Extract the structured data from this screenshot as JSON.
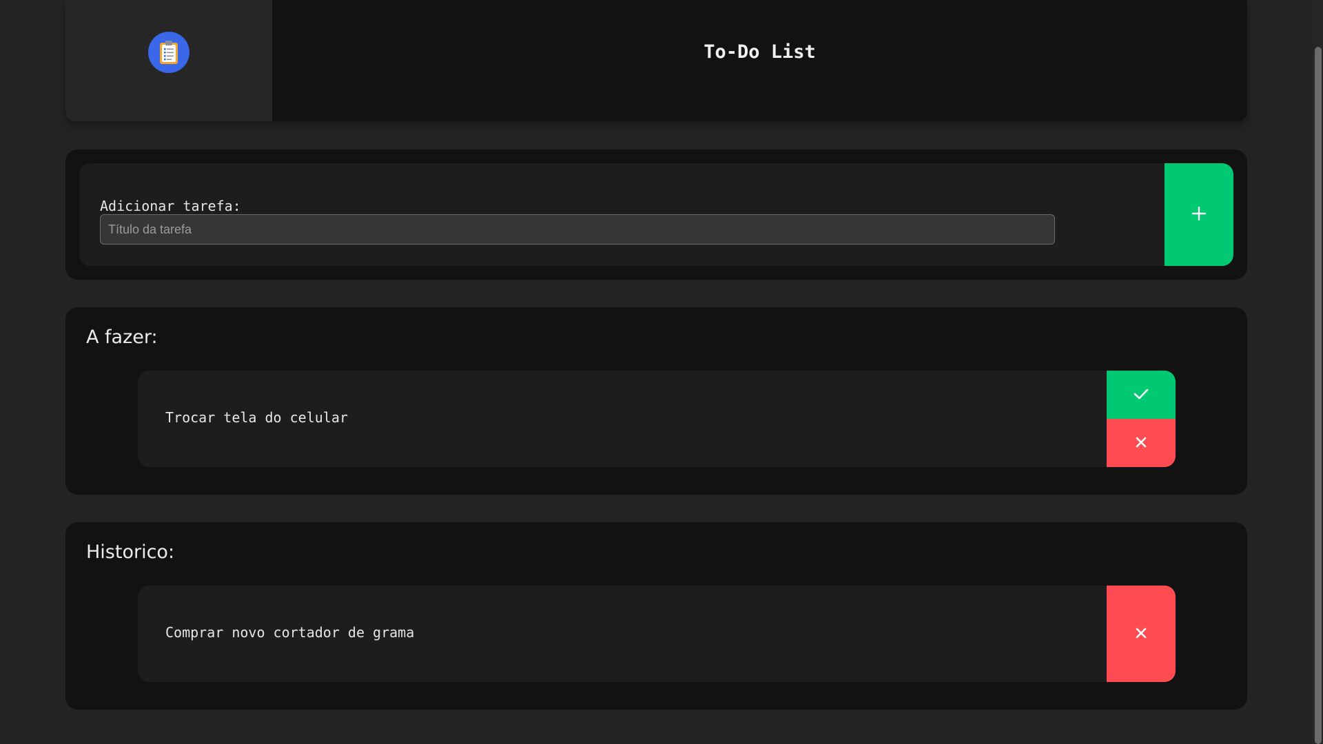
{
  "header": {
    "logo_icon": "clipboard-icon",
    "title": "To-Do List"
  },
  "add_task": {
    "label": "Adicionar tarefa:",
    "placeholder": "Título da tarefa",
    "value": "",
    "add_icon": "plus-icon"
  },
  "todo": {
    "title": "A fazer:",
    "items": [
      {
        "text": "Trocar tela do celular",
        "done_icon": "check-icon",
        "remove_icon": "close-icon"
      }
    ]
  },
  "history": {
    "title": "Historico:",
    "items": [
      {
        "text": "Comprar novo cortador de grama",
        "remove_icon": "close-icon"
      }
    ]
  },
  "colors": {
    "background": "#242424",
    "card": "#121212",
    "accent_green": "#00c873",
    "accent_red": "#ff4b52",
    "logo_blue": "#3a66e8"
  }
}
